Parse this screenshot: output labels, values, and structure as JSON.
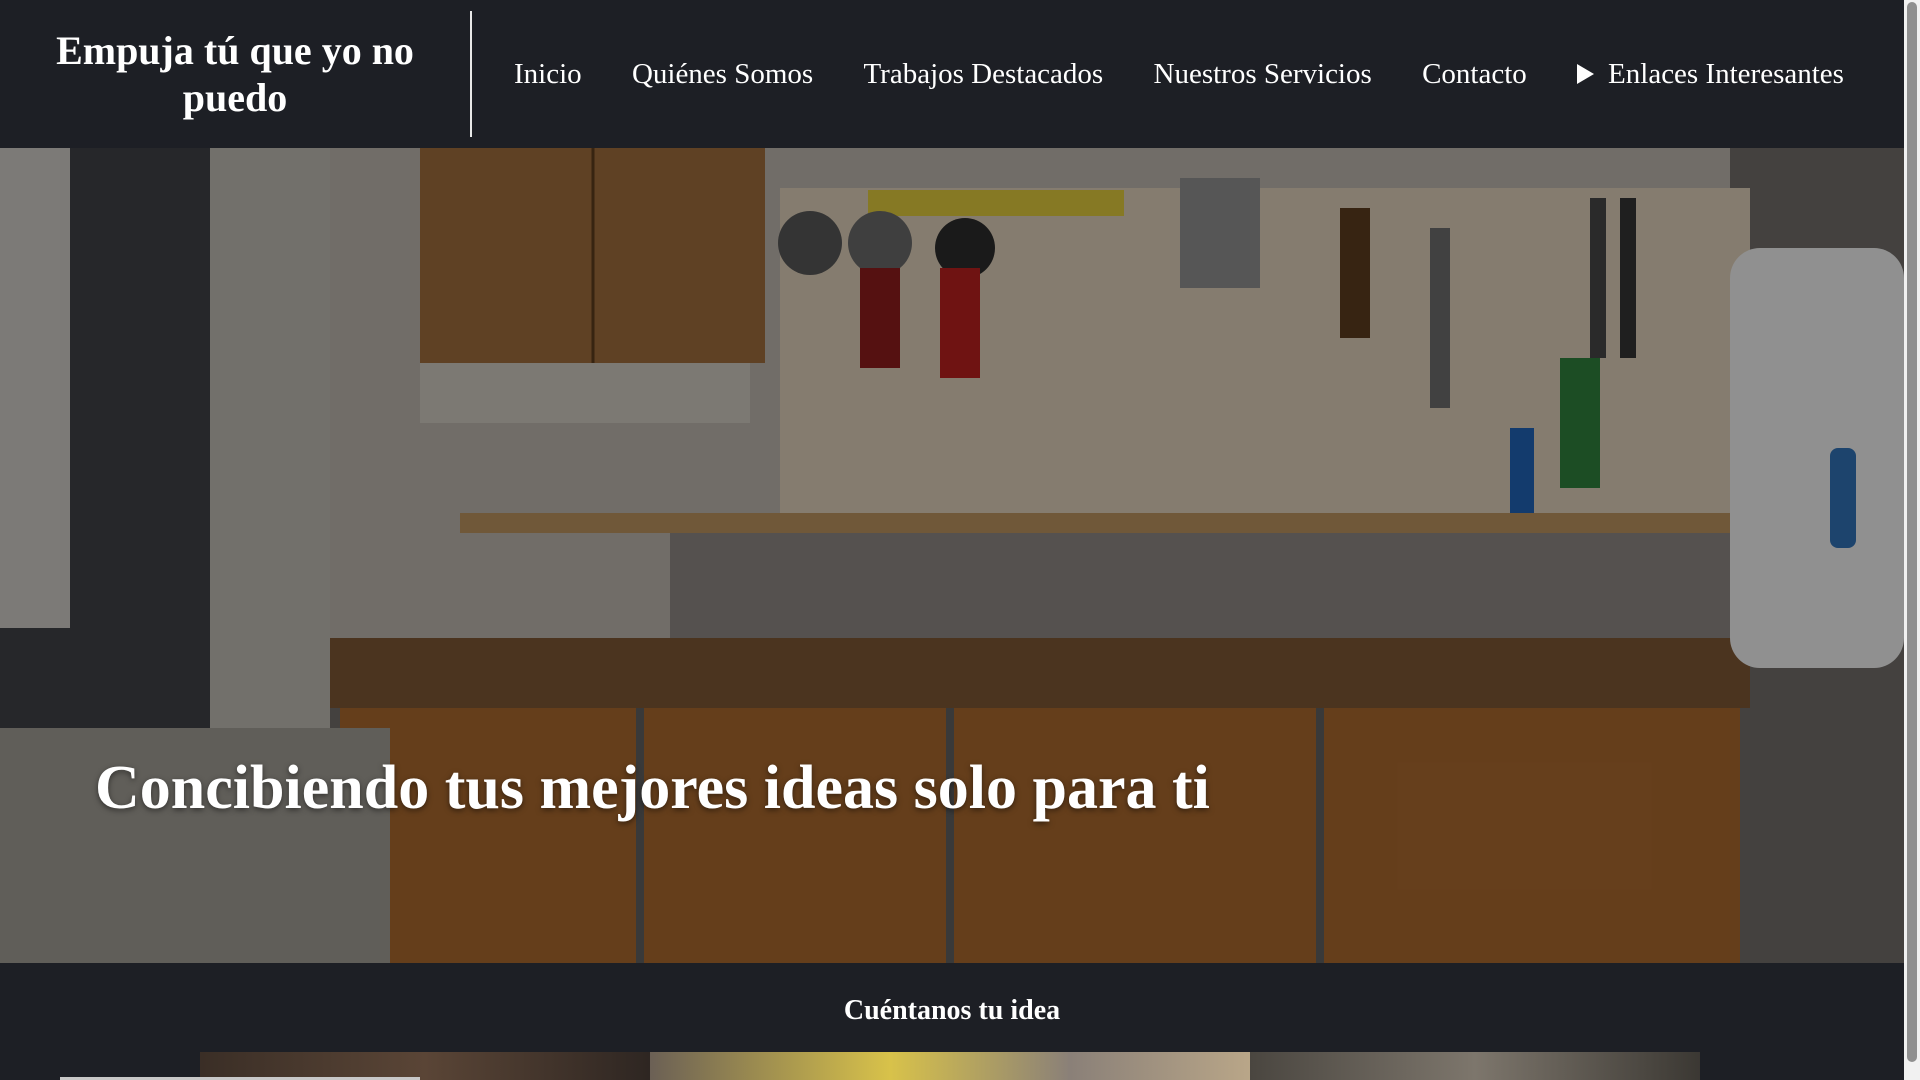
{
  "header": {
    "brand": "Empuja tú que yo no puedo",
    "nav": [
      {
        "label": "Inicio"
      },
      {
        "label": "Quiénes Somos"
      },
      {
        "label": "Trabajos Destacados"
      },
      {
        "label": "Nuestros Servicios"
      },
      {
        "label": "Contacto"
      },
      {
        "label": "Enlaces Interesantes",
        "icon": "caret-right-icon"
      }
    ]
  },
  "hero": {
    "title": "Concibiendo tus mejores ideas solo para ti",
    "image": "workshop-workbench-photo"
  },
  "section": {
    "title": "Cuéntanos tu idea"
  },
  "colors": {
    "background": "#1d1f25",
    "text": "#ffffff",
    "divider": "#e8e8e8"
  }
}
